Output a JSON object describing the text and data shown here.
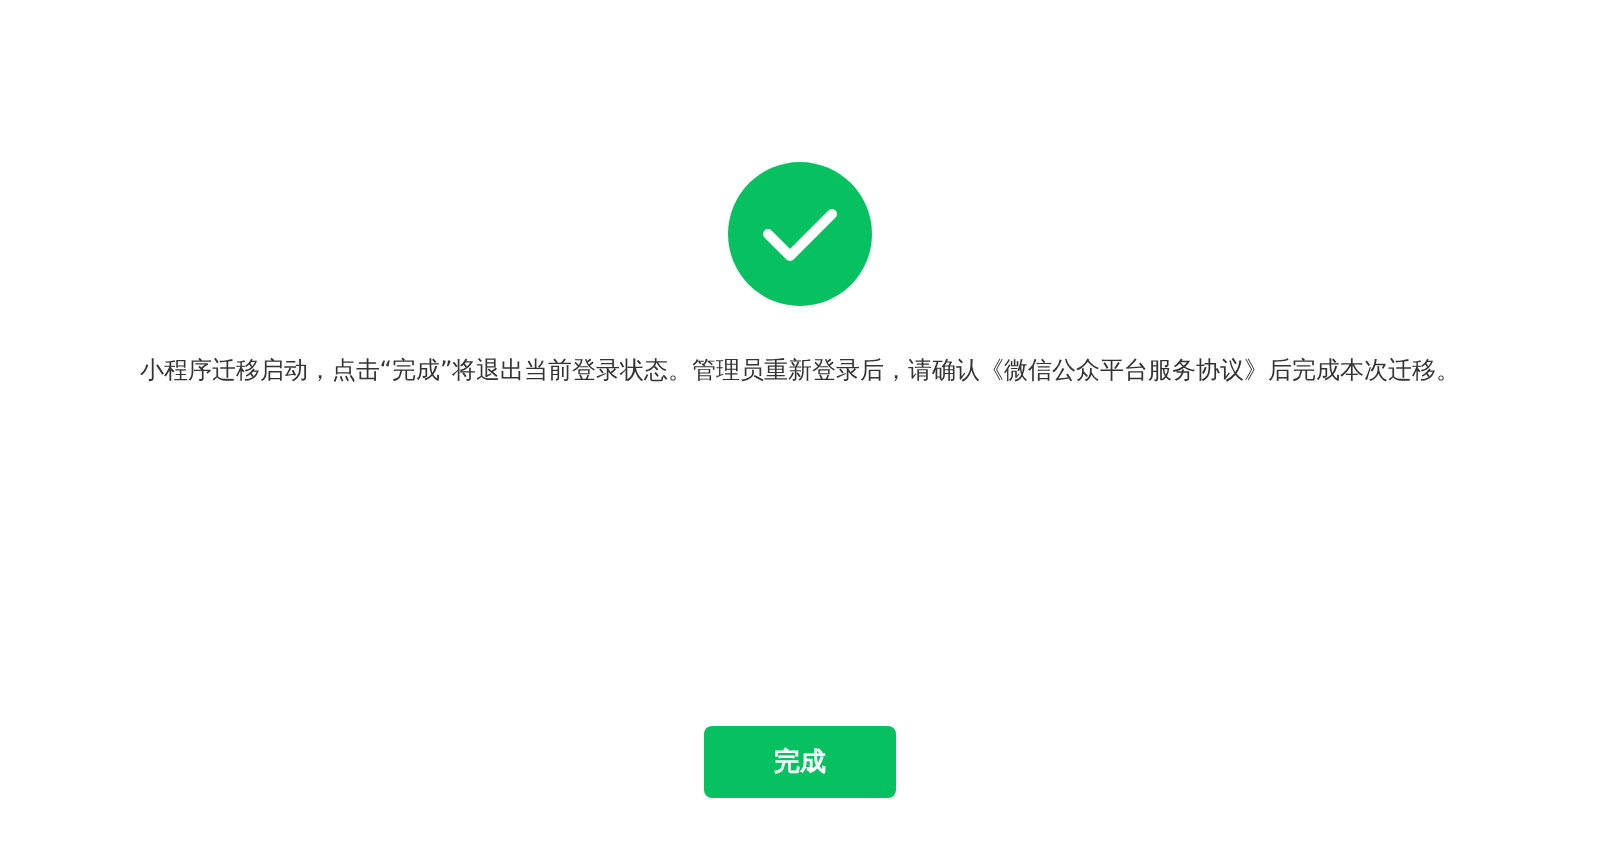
{
  "message": "小程序迁移启动，点击“完成”将退出当前登录状态。管理员重新登录后，请确认《微信公众平台服务协议》后完成本次迁移。",
  "button": "完成"
}
